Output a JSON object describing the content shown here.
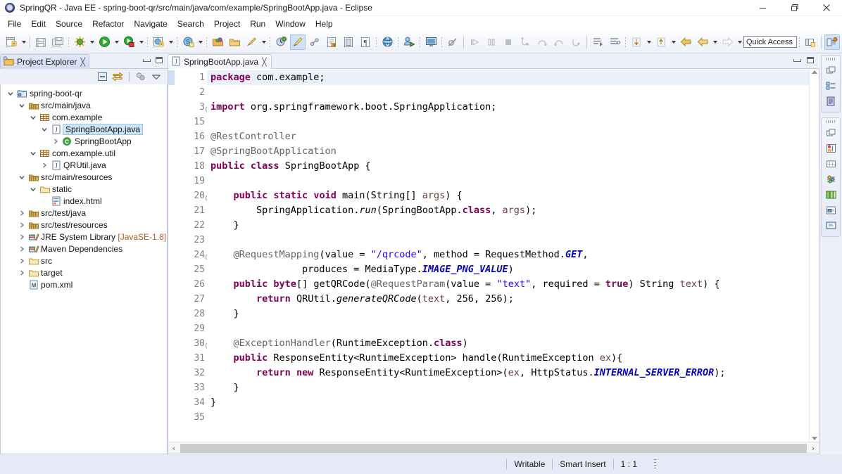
{
  "window": {
    "title": "SpringQR - Java EE - spring-boot-qr/src/main/java/com/example/SpringBootApp.java - Eclipse",
    "app_icon": "eclipse-icon",
    "minimize": "minimize-button",
    "restore": "restore-button",
    "close": "close-button"
  },
  "menubar": {
    "items": [
      {
        "label": "File"
      },
      {
        "label": "Edit"
      },
      {
        "label": "Source"
      },
      {
        "label": "Refactor"
      },
      {
        "label": "Navigate"
      },
      {
        "label": "Search"
      },
      {
        "label": "Project"
      },
      {
        "label": "Run"
      },
      {
        "label": "Window"
      },
      {
        "label": "Help"
      }
    ]
  },
  "toolbar": {
    "quick_access_placeholder": "Quick Access",
    "items": [
      {
        "name": "new-wizard-icon",
        "arrow": true
      },
      {
        "sep": true
      },
      {
        "name": "save-icon",
        "arrow": false
      },
      {
        "name": "save-all-icon",
        "arrow": false
      },
      {
        "sep_dotted": true
      },
      {
        "name": "debug-icon",
        "arrow": true
      },
      {
        "name": "run-icon",
        "arrow": true
      },
      {
        "name": "run-external-tools-icon",
        "arrow": true
      },
      {
        "sep_dotted": true
      },
      {
        "name": "new-java-project-icon",
        "arrow": true
      },
      {
        "sep_dotted": true
      },
      {
        "name": "new-class-icon",
        "arrow": true
      },
      {
        "sep_dotted": true
      },
      {
        "name": "open-type-icon",
        "arrow": false
      },
      {
        "name": "open-task-icon",
        "arrow": false
      },
      {
        "name": "search-icon",
        "arrow": true
      },
      {
        "sep_dotted": true
      },
      {
        "name": "profile-icon",
        "arrow": false
      },
      {
        "name": "highlight-icon",
        "selected": true
      },
      {
        "name": "link-icon",
        "arrow": false
      },
      {
        "name": "export-icon",
        "arrow": false
      },
      {
        "name": "book-icon",
        "arrow": false
      },
      {
        "name": "pilcrow-icon",
        "arrow": false
      },
      {
        "sep_dotted": true
      },
      {
        "name": "globe-icon",
        "arrow": false
      },
      {
        "sep_dotted": true
      },
      {
        "name": "deploy-icon",
        "arrow": false
      },
      {
        "sep_dotted": true
      },
      {
        "name": "console-icon",
        "arrow": false
      },
      {
        "sep_dotted": true
      },
      {
        "name": "skip-breakpoints-icon",
        "arrow": false
      },
      {
        "sep_solid": true
      },
      {
        "name": "resume-icon",
        "arrow": false
      },
      {
        "name": "suspend-icon",
        "arrow": false
      },
      {
        "name": "terminate-icon",
        "arrow": false
      },
      {
        "name": "step-into-icon",
        "arrow": false
      },
      {
        "name": "step-over-icon",
        "arrow": false
      },
      {
        "name": "step-return-icon",
        "arrow": false
      },
      {
        "name": "drop-to-frame-icon",
        "arrow": false
      },
      {
        "sep_solid": true
      },
      {
        "name": "next-annotation-icon",
        "arrow": false
      },
      {
        "name": "previous-annotation-icon",
        "arrow": false
      },
      {
        "sep_dotted": true
      },
      {
        "name": "next-edit-icon",
        "arrow": true
      },
      {
        "name": "previous-edit-icon",
        "arrow": true
      },
      {
        "name": "back-icon",
        "arrow": false
      },
      {
        "name": "back-history-icon",
        "arrow": true
      },
      {
        "name": "forward-icon",
        "arrow": true
      }
    ],
    "right_items": [
      {
        "name": "open-perspective-icon"
      },
      {
        "name": "java-ee-perspective-icon",
        "selected": true
      }
    ]
  },
  "explorer": {
    "tab_label": "Project Explorer",
    "tab_close": "╳",
    "toolbar": [
      {
        "name": "collapse-all-icon"
      },
      {
        "name": "link-with-editor-icon"
      },
      {
        "name": "view-menu-filter-icon"
      },
      {
        "name": "view-menu-icon"
      }
    ],
    "minimize": "minimize-view-button",
    "maximize": "maximize-view-button",
    "tree": [
      {
        "label": "spring-boot-qr",
        "icon": "project-icon",
        "indent": 0,
        "twisty": "open",
        "selected": false
      },
      {
        "label": "src/main/java",
        "icon": "source-folder-icon",
        "indent": 1,
        "twisty": "open",
        "selected": false
      },
      {
        "label": "com.example",
        "icon": "package-icon",
        "indent": 2,
        "twisty": "open",
        "selected": false
      },
      {
        "label": "SpringBootApp.java",
        "icon": "java-file-icon",
        "indent": 3,
        "twisty": "open",
        "selected": true
      },
      {
        "label": "SpringBootApp",
        "icon": "java-class-icon",
        "indent": 4,
        "twisty": "closed",
        "selected": false
      },
      {
        "label": "com.example.util",
        "icon": "package-icon",
        "indent": 2,
        "twisty": "open",
        "selected": false
      },
      {
        "label": "QRUtil.java",
        "icon": "java-file-icon",
        "indent": 3,
        "twisty": "closed",
        "selected": false
      },
      {
        "label": "src/main/resources",
        "icon": "source-folder-icon",
        "indent": 1,
        "twisty": "open",
        "selected": false
      },
      {
        "label": "static",
        "icon": "folder-icon",
        "indent": 2,
        "twisty": "open",
        "selected": false
      },
      {
        "label": "index.html",
        "icon": "html-file-icon",
        "indent": 3,
        "twisty": "none",
        "selected": false
      },
      {
        "label": "src/test/java",
        "icon": "source-folder-icon",
        "indent": 1,
        "twisty": "closed",
        "selected": false
      },
      {
        "label": "src/test/resources",
        "icon": "source-folder-icon",
        "indent": 1,
        "twisty": "closed",
        "selected": false
      },
      {
        "label": "JRE System Library",
        "suffix": "[JavaSE-1.8]",
        "icon": "library-icon",
        "indent": 1,
        "twisty": "closed",
        "selected": false
      },
      {
        "label": "Maven Dependencies",
        "icon": "library-icon",
        "indent": 1,
        "twisty": "closed",
        "selected": false
      },
      {
        "label": "src",
        "icon": "folder-icon",
        "indent": 1,
        "twisty": "closed",
        "selected": false
      },
      {
        "label": "target",
        "icon": "folder-icon",
        "indent": 1,
        "twisty": "closed",
        "selected": false
      },
      {
        "label": "pom.xml",
        "icon": "maven-file-icon",
        "indent": 1,
        "twisty": "none",
        "selected": false
      }
    ]
  },
  "editor": {
    "tab_label": "SpringBootApp.java",
    "tab_icon": "java-file-icon",
    "tab_close": "╳",
    "minimize": "minimize-editor-button",
    "maximize": "maximize-editor-button",
    "scroll_up": "scroll-up-arrow",
    "scroll_down": "scroll-down-arrow",
    "hscroll_left": "‹",
    "hscroll_right": "›",
    "lines": [
      {
        "num": "1",
        "fold": "none",
        "highlight": true,
        "tokens": [
          {
            "t": "package ",
            "c": "k"
          },
          {
            "t": "com.example;",
            "c": ""
          }
        ]
      },
      {
        "num": "2",
        "fold": "none",
        "highlight": false,
        "tokens": []
      },
      {
        "num": "3",
        "fold": "collapsed",
        "highlight": false,
        "tokens": [
          {
            "t": "import ",
            "c": "k"
          },
          {
            "t": "org.springframework.boot.SpringApplication;",
            "c": ""
          }
        ]
      },
      {
        "num": "15",
        "fold": "none",
        "highlight": false,
        "tokens": []
      },
      {
        "num": "16",
        "fold": "none",
        "highlight": false,
        "tokens": [
          {
            "t": "@RestController",
            "c": "a"
          }
        ]
      },
      {
        "num": "17",
        "fold": "none",
        "highlight": false,
        "tokens": [
          {
            "t": "@SpringBootApplication",
            "c": "a"
          }
        ]
      },
      {
        "num": "18",
        "fold": "none",
        "highlight": false,
        "tokens": [
          {
            "t": "public ",
            "c": "k"
          },
          {
            "t": "class ",
            "c": "k"
          },
          {
            "t": "SpringBootApp {",
            "c": ""
          }
        ]
      },
      {
        "num": "19",
        "fold": "none",
        "highlight": false,
        "tokens": []
      },
      {
        "num": "20",
        "fold": "open",
        "highlight": false,
        "tokens": [
          {
            "t": "    ",
            "c": ""
          },
          {
            "t": "public ",
            "c": "k"
          },
          {
            "t": "static ",
            "c": "k"
          },
          {
            "t": "void ",
            "c": "k"
          },
          {
            "t": "main(String[] ",
            "c": ""
          },
          {
            "t": "args",
            "c": "p"
          },
          {
            "t": ") {",
            "c": ""
          }
        ]
      },
      {
        "num": "21",
        "fold": "none",
        "highlight": false,
        "tokens": [
          {
            "t": "        SpringApplication.",
            "c": ""
          },
          {
            "t": "run",
            "c": "st"
          },
          {
            "t": "(SpringBootApp.",
            "c": ""
          },
          {
            "t": "class",
            "c": "k"
          },
          {
            "t": ", ",
            "c": ""
          },
          {
            "t": "args",
            "c": "p"
          },
          {
            "t": ");",
            "c": ""
          }
        ]
      },
      {
        "num": "22",
        "fold": "none",
        "highlight": false,
        "tokens": [
          {
            "t": "    }",
            "c": ""
          }
        ]
      },
      {
        "num": "23",
        "fold": "none",
        "highlight": false,
        "tokens": []
      },
      {
        "num": "24",
        "fold": "open",
        "highlight": false,
        "tokens": [
          {
            "t": "    ",
            "c": ""
          },
          {
            "t": "@RequestMapping",
            "c": "a"
          },
          {
            "t": "(value = ",
            "c": ""
          },
          {
            "t": "\"/qrcode\"",
            "c": "s"
          },
          {
            "t": ", method = RequestMethod.",
            "c": ""
          },
          {
            "t": "GET",
            "c": "f"
          },
          {
            "t": ",",
            "c": ""
          }
        ]
      },
      {
        "num": "25",
        "fold": "none",
        "highlight": false,
        "tokens": [
          {
            "t": "                produces = MediaType.",
            "c": ""
          },
          {
            "t": "IMAGE_PNG_VALUE",
            "c": "f"
          },
          {
            "t": ")",
            "c": ""
          }
        ]
      },
      {
        "num": "26",
        "fold": "none",
        "highlight": false,
        "tokens": [
          {
            "t": "    ",
            "c": ""
          },
          {
            "t": "public ",
            "c": "k"
          },
          {
            "t": "byte",
            "c": "k"
          },
          {
            "t": "[] getQRCode(",
            "c": ""
          },
          {
            "t": "@RequestParam",
            "c": "a"
          },
          {
            "t": "(value = ",
            "c": ""
          },
          {
            "t": "\"text\"",
            "c": "s"
          },
          {
            "t": ", required = ",
            "c": ""
          },
          {
            "t": "true",
            "c": "k"
          },
          {
            "t": ") String ",
            "c": ""
          },
          {
            "t": "text",
            "c": "p"
          },
          {
            "t": ") {",
            "c": ""
          }
        ]
      },
      {
        "num": "27",
        "fold": "none",
        "highlight": false,
        "tokens": [
          {
            "t": "        ",
            "c": ""
          },
          {
            "t": "return ",
            "c": "k"
          },
          {
            "t": "QRUtil.",
            "c": ""
          },
          {
            "t": "generateQRCode",
            "c": "st"
          },
          {
            "t": "(",
            "c": ""
          },
          {
            "t": "text",
            "c": "p"
          },
          {
            "t": ", 256, 256);",
            "c": ""
          }
        ]
      },
      {
        "num": "28",
        "fold": "none",
        "highlight": false,
        "tokens": [
          {
            "t": "    }",
            "c": ""
          }
        ]
      },
      {
        "num": "29",
        "fold": "none",
        "highlight": false,
        "tokens": []
      },
      {
        "num": "30",
        "fold": "open",
        "highlight": false,
        "tokens": [
          {
            "t": "    ",
            "c": ""
          },
          {
            "t": "@ExceptionHandler",
            "c": "a"
          },
          {
            "t": "(RuntimeException.",
            "c": ""
          },
          {
            "t": "class",
            "c": "k"
          },
          {
            "t": ")",
            "c": ""
          }
        ]
      },
      {
        "num": "31",
        "fold": "none",
        "highlight": false,
        "tokens": [
          {
            "t": "    ",
            "c": ""
          },
          {
            "t": "public ",
            "c": "k"
          },
          {
            "t": "ResponseEntity<RuntimeException> handle(RuntimeException ",
            "c": ""
          },
          {
            "t": "ex",
            "c": "p"
          },
          {
            "t": "){",
            "c": ""
          }
        ]
      },
      {
        "num": "32",
        "fold": "none",
        "highlight": false,
        "tokens": [
          {
            "t": "        ",
            "c": ""
          },
          {
            "t": "return ",
            "c": "k"
          },
          {
            "t": "new ",
            "c": "k"
          },
          {
            "t": "ResponseEntity<RuntimeException>(",
            "c": ""
          },
          {
            "t": "ex",
            "c": "p"
          },
          {
            "t": ", HttpStatus.",
            "c": ""
          },
          {
            "t": "INTERNAL_SERVER_ERROR",
            "c": "f"
          },
          {
            "t": ");",
            "c": ""
          }
        ]
      },
      {
        "num": "33",
        "fold": "none",
        "highlight": false,
        "tokens": [
          {
            "t": "    }",
            "c": ""
          }
        ]
      },
      {
        "num": "34",
        "fold": "none",
        "highlight": false,
        "tokens": [
          {
            "t": "}",
            "c": ""
          }
        ]
      },
      {
        "num": "35",
        "fold": "none",
        "highlight": false,
        "tokens": []
      }
    ]
  },
  "fastbar": {
    "groups": [
      {
        "items": [
          {
            "name": "restore-views-icon"
          },
          {
            "name": "outline-view-icon"
          },
          {
            "name": "task-list-view-icon"
          }
        ]
      },
      {
        "items": [
          {
            "name": "restore-views-icon"
          },
          {
            "name": "servers-view-icon"
          },
          {
            "name": "data-source-explorer-icon"
          },
          {
            "name": "properties-view-icon"
          },
          {
            "name": "snippets-view-icon"
          },
          {
            "name": "markers-view-icon"
          },
          {
            "name": "console-view-icon"
          }
        ]
      }
    ]
  },
  "statusbar": {
    "writable": "Writable",
    "insert_mode": "Smart Insert",
    "cursor_position": "1 : 1"
  },
  "colors": {
    "selection_blue": "#cde6f7",
    "keyword_magenta": "#7f0055",
    "string_blue": "#2a00ff",
    "static_field_blue": "#0000c0",
    "annotation_gray": "#646464",
    "panel_bg": "#eef0f8"
  }
}
